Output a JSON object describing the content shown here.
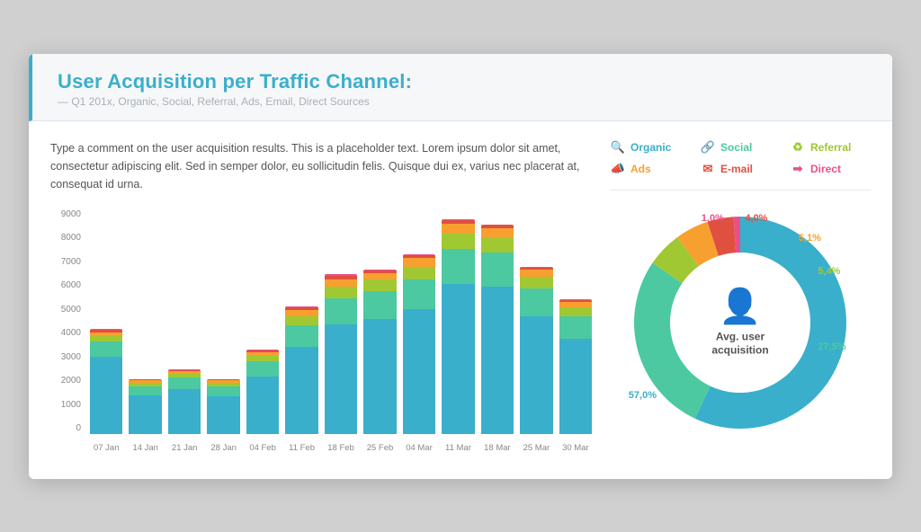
{
  "header": {
    "title": "User Acquisition per Traffic Channel:",
    "subtitle": "— Q1 201x, Organic, Social, Referral, Ads, Email, Direct Sources"
  },
  "comment": "Type a comment on the user acquisition results. This is a placeholder text. Lorem ipsum dolor sit amet, consectetur adipiscing elit. Sed in semper dolor, eu sollicitudin felis. Quisque dui ex, varius nec placerat at, consequat id urna.",
  "legend": [
    {
      "label": "Organic",
      "color": "#3aafcc",
      "icon": "🔍"
    },
    {
      "label": "Social",
      "color": "#4cc9a0",
      "icon": "🔗"
    },
    {
      "label": "Referral",
      "color": "#a0c832",
      "icon": "♻"
    },
    {
      "label": "Ads",
      "color": "#f7a030",
      "icon": "📣"
    },
    {
      "label": "E-mail",
      "color": "#e05040",
      "icon": "✉"
    },
    {
      "label": "Direct",
      "color": "#e8508a",
      "icon": "➡"
    }
  ],
  "yLabels": [
    "9000",
    "8000",
    "7000",
    "6000",
    "5000",
    "4000",
    "3000",
    "2000",
    "1000",
    "0"
  ],
  "xLabels": [
    "07 Jan",
    "14 Jan",
    "21 Jan",
    "28 Jan",
    "04 Feb",
    "11 Feb",
    "18 Feb",
    "25 Feb",
    "04 Mar",
    "11 Mar",
    "18 Mar",
    "25 Mar",
    "30 Mar"
  ],
  "bars": [
    {
      "total": 4200,
      "segments": [
        3100,
        600,
        200,
        150,
        100,
        50
      ]
    },
    {
      "total": 2200,
      "segments": [
        1550,
        350,
        130,
        100,
        50,
        20
      ]
    },
    {
      "total": 2600,
      "segments": [
        1800,
        450,
        160,
        110,
        60,
        30
      ]
    },
    {
      "total": 2200,
      "segments": [
        1500,
        400,
        140,
        100,
        50,
        10
      ]
    },
    {
      "total": 3400,
      "segments": [
        2300,
        600,
        220,
        160,
        80,
        40
      ]
    },
    {
      "total": 5100,
      "segments": [
        3500,
        850,
        350,
        250,
        100,
        50
      ]
    },
    {
      "total": 6400,
      "segments": [
        4400,
        1050,
        450,
        300,
        140,
        60
      ]
    },
    {
      "total": 6600,
      "segments": [
        4600,
        1100,
        460,
        300,
        100,
        40
      ]
    },
    {
      "total": 7200,
      "segments": [
        5000,
        1200,
        500,
        350,
        100,
        50
      ]
    },
    {
      "total": 8600,
      "segments": [
        6000,
        1400,
        600,
        400,
        150,
        50
      ]
    },
    {
      "total": 8400,
      "segments": [
        5900,
        1350,
        580,
        380,
        140,
        50
      ]
    },
    {
      "total": 6700,
      "segments": [
        4700,
        1100,
        450,
        300,
        110,
        40
      ]
    },
    {
      "total": 5400,
      "segments": [
        3800,
        900,
        360,
        230,
        90,
        20
      ]
    }
  ],
  "donut": {
    "segments": [
      {
        "label": "Organic",
        "pct": 57.0,
        "color": "#3aafcc",
        "pctLabel": "57,0%",
        "pos": {
          "top": "78%",
          "left": "4%"
        }
      },
      {
        "label": "Social",
        "pct": 27.5,
        "color": "#4cc9a0",
        "pctLabel": "27,5%",
        "pos": {
          "top": "58%",
          "left": "82%"
        }
      },
      {
        "label": "Referral",
        "pct": 5.4,
        "color": "#a0c832",
        "pctLabel": "5,4%",
        "pos": {
          "top": "27%",
          "left": "82%"
        }
      },
      {
        "label": "Ads",
        "pct": 5.1,
        "color": "#f7a030",
        "pctLabel": "5,1%",
        "pos": {
          "top": "13%",
          "left": "74%"
        }
      },
      {
        "label": "E-mail",
        "pct": 4.0,
        "color": "#e05040",
        "pctLabel": "4,0%",
        "pos": {
          "top": "5%",
          "left": "52%"
        }
      },
      {
        "label": "Direct",
        "pct": 1.0,
        "color": "#e8508a",
        "pctLabel": "1,0%",
        "pos": {
          "top": "5%",
          "left": "34%"
        }
      }
    ],
    "center_label": "Avg. user\nacquisition"
  }
}
